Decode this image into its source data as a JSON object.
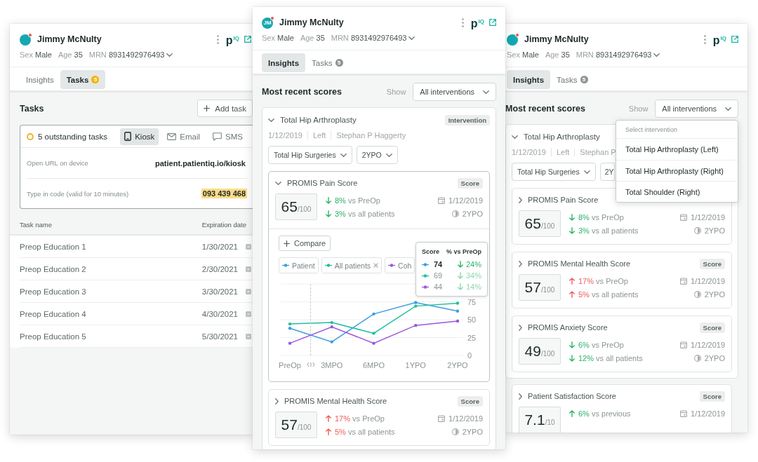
{
  "panels": [
    {
      "kind": "tasks",
      "patient": {
        "name": "Jimmy McNulty",
        "alert": true,
        "meta": [
          {
            "label": "Sex",
            "value": "Male"
          },
          {
            "label": "Age",
            "value": "35"
          },
          {
            "label": "MRN",
            "value": "8931492976493"
          }
        ]
      },
      "logo": "p$^{IQ}$",
      "tabs": [
        {
          "label": "Insights",
          "selected": false
        },
        {
          "label": "Tasks",
          "badge": "5",
          "selected": true
        }
      ],
      "tasks": {
        "title": "Tasks",
        "add_button": "Add task",
        "status": "5 outstanding tasks",
        "channels": [
          {
            "kind": "kiosk",
            "label": "Kiosk",
            "selected": true
          },
          {
            "kind": "email",
            "label": "Email",
            "selected": false
          },
          {
            "kind": "sms",
            "label": "SMS",
            "selected": false
          }
        ],
        "details": [
          {
            "label": "Open URL on device",
            "value": "patient.patientiq.io/kiosk",
            "highlighted": false
          },
          {
            "label": "Type in code (valid for 10 minutes)",
            "value": "093 439 468",
            "highlighted": true
          }
        ],
        "table": {
          "columns": [
            "Task name",
            "Expiration date"
          ],
          "rows": [
            {
              "name": "Preop Education 1",
              "expires": "1/30/2021"
            },
            {
              "name": "Preop Education 2",
              "expires": "2/30/2021"
            },
            {
              "name": "Preop Education 3",
              "expires": "3/30/2021"
            },
            {
              "name": "Preop Education 4",
              "expires": "4/30/2021"
            },
            {
              "name": "Preop Education 5",
              "expires": "5/30/2021"
            }
          ]
        }
      }
    },
    {
      "kind": "insights",
      "patient": {
        "name": "Jimmy McNulty",
        "initials": "JM",
        "alert": true,
        "meta": [
          {
            "label": "Sex",
            "value": "Male"
          },
          {
            "label": "Age",
            "value": "35"
          },
          {
            "label": "MRN",
            "value": "8931492976493"
          }
        ]
      },
      "logo": "p$^{IQ}$",
      "tabs": [
        {
          "label": "Insights",
          "selected": true
        },
        {
          "label": "Tasks",
          "badge": "5",
          "selected": false
        }
      ],
      "insights": {
        "title": "Most recent scores",
        "filter_label": "Show",
        "filter": "All interventions",
        "interventions": [
          {
            "title": "Total Hip Arthroplasty",
            "expanded": true,
            "badge": "Intervention",
            "details": [
              "1/12/2019",
              "Left",
              "Stephan P Haggerty"
            ],
            "selects": [
              {
                "label": "Total Hip Surgeries",
                "caret": true
              },
              {
                "label": "2YPO",
                "caret": true
              }
            ],
            "scores": [
              {
                "title": "PROMIS Pain Score",
                "expanded": true,
                "badge": "Score",
                "value": "65",
                "scale": "/100",
                "deltas": [
                  {
                    "up": false,
                    "good": true,
                    "amount": "8%",
                    "text": "vs PreOp"
                  },
                  {
                    "up": false,
                    "good": true,
                    "amount": "3%",
                    "text": "vs all patients"
                  }
                ],
                "date": "1/12/2019",
                "timepoint": "2YPO",
                "chart": {
                  "compare_button": "Compare",
                  "legend": [
                    {
                      "removable": false
                    },
                    {
                      "removable": true
                    },
                    {
                      "removable": false
                    }
                  ],
                  "chart_data": {
                    "type": "line",
                    "categories": [
                      "PreOp",
                      "3MPO",
                      "6MPO",
                      "1YPO",
                      "2YPO"
                    ],
                    "ylim": [
                      0,
                      100
                    ],
                    "yticks": [
                      0,
                      25,
                      50,
                      75
                    ],
                    "grid": true,
                    "series": [
                      {
                        "name": "Patient",
                        "color": "#3b9de0",
                        "values": [
                          38,
                          19,
                          58,
                          74,
                          62
                        ]
                      },
                      {
                        "name": "All patients",
                        "color": "#1fbf9f",
                        "values": [
                          44,
                          46,
                          31,
                          69,
                          73
                        ]
                      },
                      {
                        "name": "Coh",
                        "color": "#9b55e0",
                        "values": [
                          17,
                          40,
                          17,
                          42,
                          48
                        ]
                      }
                    ]
                  },
                  "tooltip": {
                    "columns": [
                      "Score",
                      "% vs PreOp"
                    ],
                    "rows": [
                      {
                        "value": "74",
                        "change": "24%",
                        "up": false,
                        "selected": true
                      },
                      {
                        "value": "69",
                        "change": "34%",
                        "up": false,
                        "selected": false
                      },
                      {
                        "value": "44",
                        "change": "14%",
                        "up": false,
                        "selected": false
                      }
                    ]
                  }
                }
              },
              {
                "title": "PROMIS Mental Health Score",
                "expanded": false,
                "badge": "Score",
                "value": "57",
                "scale": "/100",
                "deltas": [
                  {
                    "up": true,
                    "good": false,
                    "amount": "17%",
                    "text": "vs PreOp"
                  },
                  {
                    "up": true,
                    "good": false,
                    "amount": "5%",
                    "text": "vs all patients"
                  }
                ],
                "date": "1/12/2019",
                "timepoint": "2YPO"
              }
            ]
          }
        ]
      }
    },
    {
      "kind": "insights",
      "patient": {
        "name": "Jimmy McNulty",
        "alert": true,
        "meta": [
          {
            "label": "Sex",
            "value": "Male"
          },
          {
            "label": "Age",
            "value": "35"
          },
          {
            "label": "MRN",
            "value": "8931492976493"
          }
        ]
      },
      "logo": "p$^{IQ}$",
      "tabs": [
        {
          "label": "Insights",
          "selected": true
        },
        {
          "label": "Tasks",
          "badge": "5",
          "selected": false
        }
      ],
      "insights": {
        "title": "Most recent scores",
        "filter_label": "Show",
        "filter": "All interventions",
        "menu": {
          "header": "Select intervention",
          "items": [
            {
              "label": "Total Hip Arthroplasty (Left)",
              "selected": false
            },
            {
              "label": "Total Hip Arthroplasty (Right)",
              "selected": false
            },
            {
              "label": "Total Shoulder (Right)",
              "selected": false
            }
          ]
        },
        "interventions": [
          {
            "title": "Total Hip Arthroplasty",
            "expanded": true,
            "details": [
              "1/12/2019",
              "Left",
              "Stephan P"
            ],
            "selects": [
              {
                "label": "Total Hip Surgeries",
                "caret": true
              },
              {
                "label": "2Y",
                "caret": false
              }
            ],
            "scores": [
              {
                "title": "PROMIS Pain Score",
                "expanded": false,
                "value": "65",
                "scale": "/100",
                "deltas": [
                  {
                    "up": false,
                    "good": true,
                    "amount": "8%",
                    "text": "vs PreOp"
                  },
                  {
                    "up": false,
                    "good": true,
                    "amount": "3%",
                    "text": "vs all patients"
                  }
                ],
                "date": "1/12/2019",
                "timepoint": "2YPO"
              },
              {
                "title": "PROMIS Mental Health Score",
                "expanded": false,
                "badge": "Score",
                "value": "57",
                "scale": "/100",
                "deltas": [
                  {
                    "up": true,
                    "good": false,
                    "amount": "17%",
                    "text": "vs PreOp"
                  },
                  {
                    "up": true,
                    "good": false,
                    "amount": "5%",
                    "text": "vs all patients"
                  }
                ],
                "date": "1/12/2019",
                "timepoint": "2YPO"
              },
              {
                "title": "PROMIS Anxiety Score",
                "expanded": false,
                "badge": "Score",
                "value": "49",
                "scale": "/100",
                "deltas": [
                  {
                    "up": false,
                    "good": true,
                    "amount": "6%",
                    "text": "vs PreOp"
                  },
                  {
                    "up": false,
                    "good": true,
                    "amount": "12%",
                    "text": "vs all patients"
                  }
                ],
                "date": "1/12/2019",
                "timepoint": "2YPO"
              }
            ]
          }
        ],
        "other_scores": [
          {
            "title": "Patient Satisfaction Score",
            "expanded": false,
            "badge": "Score",
            "value": "7.1",
            "scale": "/10",
            "deltas": [
              {
                "up": true,
                "good": true,
                "amount": "6%",
                "text": "vs previous"
              }
            ],
            "date": "1/12/2019"
          }
        ]
      }
    }
  ]
}
